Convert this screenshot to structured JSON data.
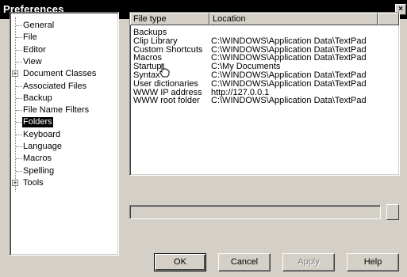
{
  "window": {
    "title": "Preferences",
    "close_label": "×"
  },
  "tree": {
    "items": [
      {
        "label": "General",
        "expander": ""
      },
      {
        "label": "File",
        "expander": ""
      },
      {
        "label": "Editor",
        "expander": ""
      },
      {
        "label": "View",
        "expander": ""
      },
      {
        "label": "Document Classes",
        "expander": "+"
      },
      {
        "label": "Associated Files",
        "expander": ""
      },
      {
        "label": "Backup",
        "expander": ""
      },
      {
        "label": "File Name Filters",
        "expander": ""
      },
      {
        "label": "Folders",
        "expander": "",
        "selected": true
      },
      {
        "label": "Keyboard",
        "expander": ""
      },
      {
        "label": "Language",
        "expander": ""
      },
      {
        "label": "Macros",
        "expander": ""
      },
      {
        "label": "Spelling",
        "expander": ""
      },
      {
        "label": "Tools",
        "expander": "+"
      }
    ]
  },
  "list": {
    "columns": [
      "File type",
      "Location"
    ],
    "rows": [
      [
        "Backups",
        ""
      ],
      [
        "Clip Library",
        "C:\\WINDOWS\\Application Data\\TextPad"
      ],
      [
        "Custom Shortcuts",
        "C:\\WINDOWS\\Application Data\\TextPad"
      ],
      [
        "Macros",
        "C:\\WINDOWS\\Application Data\\TextPad"
      ],
      [
        "Startup",
        "C:\\My Documents"
      ],
      [
        "Syntax",
        "C:\\WINDOWS\\Application Data\\TextPad"
      ],
      [
        "User dictionaries",
        "C:\\WINDOWS\\Application Data\\TextPad"
      ],
      [
        "WWW IP address",
        "http://127.0.0.1"
      ],
      [
        "WWW root folder",
        "C:\\WINDOWS\\Application Data\\TextPad"
      ]
    ]
  },
  "buttons": {
    "ok": "OK",
    "cancel": "Cancel",
    "apply": "Apply",
    "help": "Help"
  },
  "colors": {
    "face": "#d4d0c8",
    "selection": "#000000",
    "titlebar": "#000000"
  }
}
